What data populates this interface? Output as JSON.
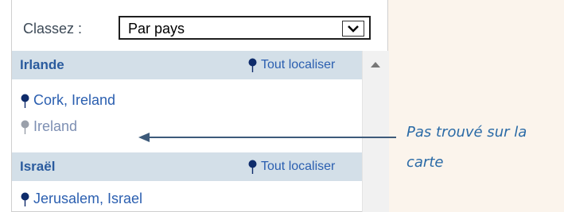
{
  "sort": {
    "label": "Classez :",
    "selected": "Par pays"
  },
  "groups": [
    {
      "title": "Irlande",
      "locate_all": "Tout localiser",
      "items": [
        {
          "label": "Cork, Ireland",
          "status": "found"
        },
        {
          "label": "Ireland",
          "status": "not-found"
        }
      ]
    },
    {
      "title": "Israël",
      "locate_all": "Tout localiser",
      "items": [
        {
          "label": "Jerusalem, Israel",
          "status": "found"
        }
      ]
    }
  ],
  "annotation": {
    "text": "Pas trouvé sur la carte"
  },
  "colors": {
    "pin_found": "#0f2c6b",
    "pin_not_found": "#9aa0aa",
    "header_bg": "#d3dfe8",
    "annotation": "#2a6aa6"
  }
}
